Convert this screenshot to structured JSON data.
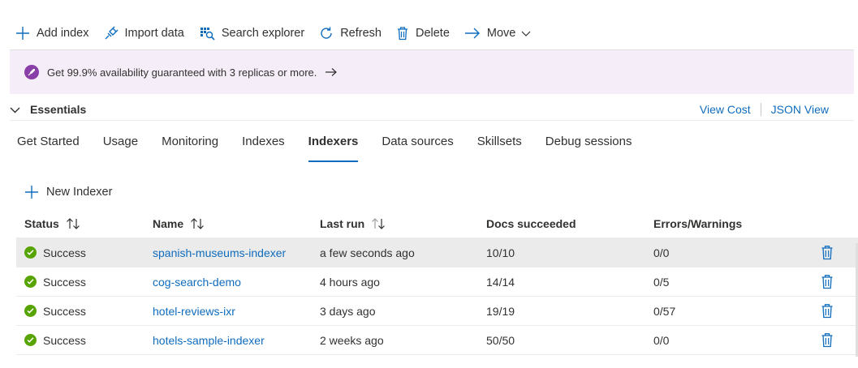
{
  "toolbar": {
    "add_index": "Add index",
    "import_data": "Import data",
    "search_explorer": "Search explorer",
    "refresh": "Refresh",
    "delete": "Delete",
    "move": "Move"
  },
  "banner": {
    "text": "Get 99.9% availability guaranteed with 3 replicas or more."
  },
  "essentials": {
    "title": "Essentials",
    "view_cost": "View Cost",
    "json_view": "JSON View"
  },
  "tabs": [
    {
      "label": "Get Started"
    },
    {
      "label": "Usage"
    },
    {
      "label": "Monitoring"
    },
    {
      "label": "Indexes"
    },
    {
      "label": "Indexers"
    },
    {
      "label": "Data sources"
    },
    {
      "label": "Skillsets"
    },
    {
      "label": "Debug sessions"
    }
  ],
  "active_tab": "Indexers",
  "new_indexer": "New Indexer",
  "table": {
    "columns": [
      "Status",
      "Name",
      "Last run",
      "Docs succeeded",
      "Errors/Warnings"
    ],
    "rows": [
      {
        "status": "Success",
        "name": "spanish-museums-indexer",
        "last_run": "a few seconds ago",
        "docs": "10/10",
        "errors": "0/0"
      },
      {
        "status": "Success",
        "name": "cog-search-demo",
        "last_run": "4 hours ago",
        "docs": "14/14",
        "errors": "0/5"
      },
      {
        "status": "Success",
        "name": "hotel-reviews-ixr",
        "last_run": "3 days ago",
        "docs": "19/19",
        "errors": "0/57"
      },
      {
        "status": "Success",
        "name": "hotels-sample-indexer",
        "last_run": "2 weeks ago",
        "docs": "50/50",
        "errors": "0/0"
      }
    ]
  },
  "colors": {
    "accent": "#0f6cbd",
    "success": "#57a300",
    "banner_bg": "#f5eef8",
    "rocket": "#8a3ea7"
  }
}
